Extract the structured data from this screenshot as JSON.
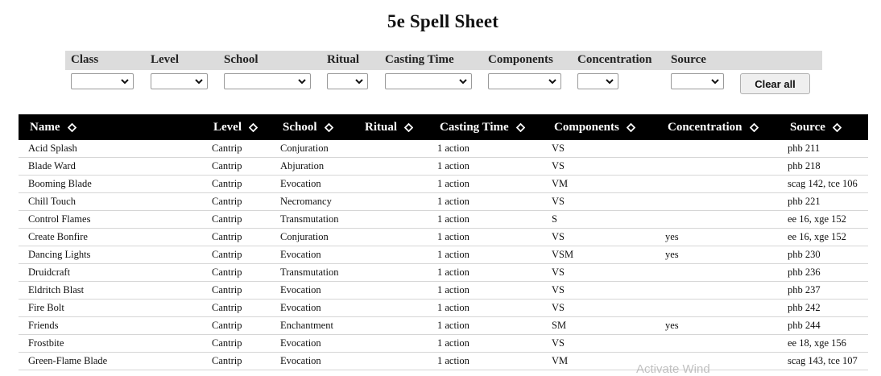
{
  "page": {
    "title": "5e Spell Sheet"
  },
  "filters": {
    "labels": [
      "Class",
      "Level",
      "School",
      "Ritual",
      "Casting Time",
      "Components",
      "Concentration",
      "Source"
    ],
    "clear_label": "Clear all"
  },
  "table": {
    "columns": [
      "Name",
      "Level",
      "School",
      "Ritual",
      "Casting Time",
      "Components",
      "Concentration",
      "Source"
    ],
    "rows": [
      [
        "Acid Splash",
        "Cantrip",
        "Conjuration",
        "",
        "1 action",
        "VS",
        "",
        "phb 211"
      ],
      [
        "Blade Ward",
        "Cantrip",
        "Abjuration",
        "",
        "1 action",
        "VS",
        "",
        "phb 218"
      ],
      [
        "Booming Blade",
        "Cantrip",
        "Evocation",
        "",
        "1 action",
        "VM",
        "",
        "scag 142, tce 106"
      ],
      [
        "Chill Touch",
        "Cantrip",
        "Necromancy",
        "",
        "1 action",
        "VS",
        "",
        "phb 221"
      ],
      [
        "Control Flames",
        "Cantrip",
        "Transmutation",
        "",
        "1 action",
        "S",
        "",
        "ee 16, xge 152"
      ],
      [
        "Create Bonfire",
        "Cantrip",
        "Conjuration",
        "",
        "1 action",
        "VS",
        "yes",
        "ee 16, xge 152"
      ],
      [
        "Dancing Lights",
        "Cantrip",
        "Evocation",
        "",
        "1 action",
        "VSM",
        "yes",
        "phb 230"
      ],
      [
        "Druidcraft",
        "Cantrip",
        "Transmutation",
        "",
        "1 action",
        "VS",
        "",
        "phb 236"
      ],
      [
        "Eldritch Blast",
        "Cantrip",
        "Evocation",
        "",
        "1 action",
        "VS",
        "",
        "phb 237"
      ],
      [
        "Fire Bolt",
        "Cantrip",
        "Evocation",
        "",
        "1 action",
        "VS",
        "",
        "phb 242"
      ],
      [
        "Friends",
        "Cantrip",
        "Enchantment",
        "",
        "1 action",
        "SM",
        "yes",
        "phb 244"
      ],
      [
        "Frostbite",
        "Cantrip",
        "Evocation",
        "",
        "1 action",
        "VS",
        "",
        "ee 18, xge 156"
      ],
      [
        "Green-Flame Blade",
        "Cantrip",
        "Evocation",
        "",
        "1 action",
        "VM",
        "",
        "scag 143, tce 107"
      ]
    ]
  },
  "overlay": {
    "watermark": "Activate Wind"
  }
}
